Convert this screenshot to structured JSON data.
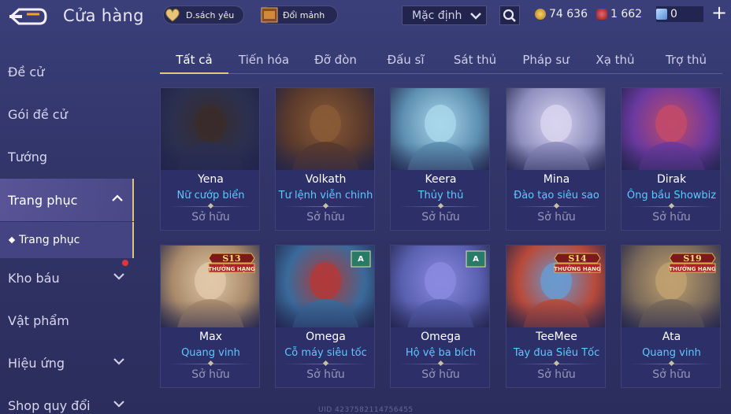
{
  "header": {
    "title": "Cửa hàng",
    "wishlist_label": "D.sách yêu",
    "exchange_label": "Đổi mảnh",
    "sort_value": "Mặc định",
    "currency": {
      "gold": "74 636",
      "ruby": "1 662",
      "voucher": "0"
    },
    "plus_label": "+"
  },
  "sidebar": {
    "items": [
      {
        "label": "Đề cử"
      },
      {
        "label": "Gói đề cử"
      },
      {
        "label": "Tướng"
      },
      {
        "label": "Trang phục"
      },
      {
        "label": "Trang phục"
      },
      {
        "label": "Kho báu"
      },
      {
        "label": "Vật phẩm"
      },
      {
        "label": "Hiệu ứng"
      },
      {
        "label": "Shop quy đổi"
      }
    ]
  },
  "tabs": [
    {
      "label": "Tất cả"
    },
    {
      "label": "Tiến hóa"
    },
    {
      "label": "Đỡ đòn"
    },
    {
      "label": "Đấu sĩ"
    },
    {
      "label": "Sát thủ"
    },
    {
      "label": "Pháp sư"
    },
    {
      "label": "Xạ thủ"
    },
    {
      "label": "Trợ thủ"
    }
  ],
  "cards": [
    {
      "hero": "Yena",
      "skin": "Nữ cướp biển",
      "owned": "Sở hữu",
      "bg": "#2b3050",
      "accent": "#3a2c2a"
    },
    {
      "hero": "Volkath",
      "skin": "Tư lệnh viễn chinh",
      "owned": "Sở hữu",
      "bg": "#5a3a2c",
      "accent": "#8a5a36"
    },
    {
      "hero": "Keera",
      "skin": "Thủy thủ",
      "owned": "Sở hữu",
      "bg": "#5d8fb0",
      "accent": "#a8d6ea"
    },
    {
      "hero": "Mina",
      "skin": "Đào tạo siêu sao",
      "owned": "Sở hữu",
      "bg": "#8f8fc0",
      "accent": "#d8d4ee"
    },
    {
      "hero": "Dirak",
      "skin": "Ông bầu Showbiz",
      "owned": "Sở hữu",
      "bg": "#6a3aa0",
      "accent": "#c24a6a"
    },
    {
      "hero": "Max",
      "skin": "Quang vinh",
      "owned": "Sở hữu",
      "bg": "#a88a6a",
      "accent": "#e0c8a8",
      "badge_season": "S13",
      "badge_text": "THƯỞNG HẠNG"
    },
    {
      "hero": "Omega",
      "skin": "Cỗ máy siêu tốc",
      "owned": "Sở hữu",
      "bg": "#3a6a9a",
      "accent": "#b03a3a",
      "badge_small": "A"
    },
    {
      "hero": "Omega",
      "skin": "Hộ vệ ba bích",
      "owned": "Sở hữu",
      "bg": "#5a60b0",
      "accent": "#8a8ae0",
      "badge_small": "A"
    },
    {
      "hero": "TeeMee",
      "skin": "Tay đua Siêu Tốc",
      "owned": "Sở hữu",
      "bg": "#b84a3a",
      "accent": "#6a9ad0",
      "badge_season": "S14",
      "badge_text": "THƯỞNG HẠNG"
    },
    {
      "hero": "Ata",
      "skin": "Quang vinh",
      "owned": "Sở hữu",
      "bg": "#7a6a5a",
      "accent": "#c0a070",
      "badge_season": "S19",
      "badge_text": "THƯỞNG HẠNG"
    }
  ]
}
